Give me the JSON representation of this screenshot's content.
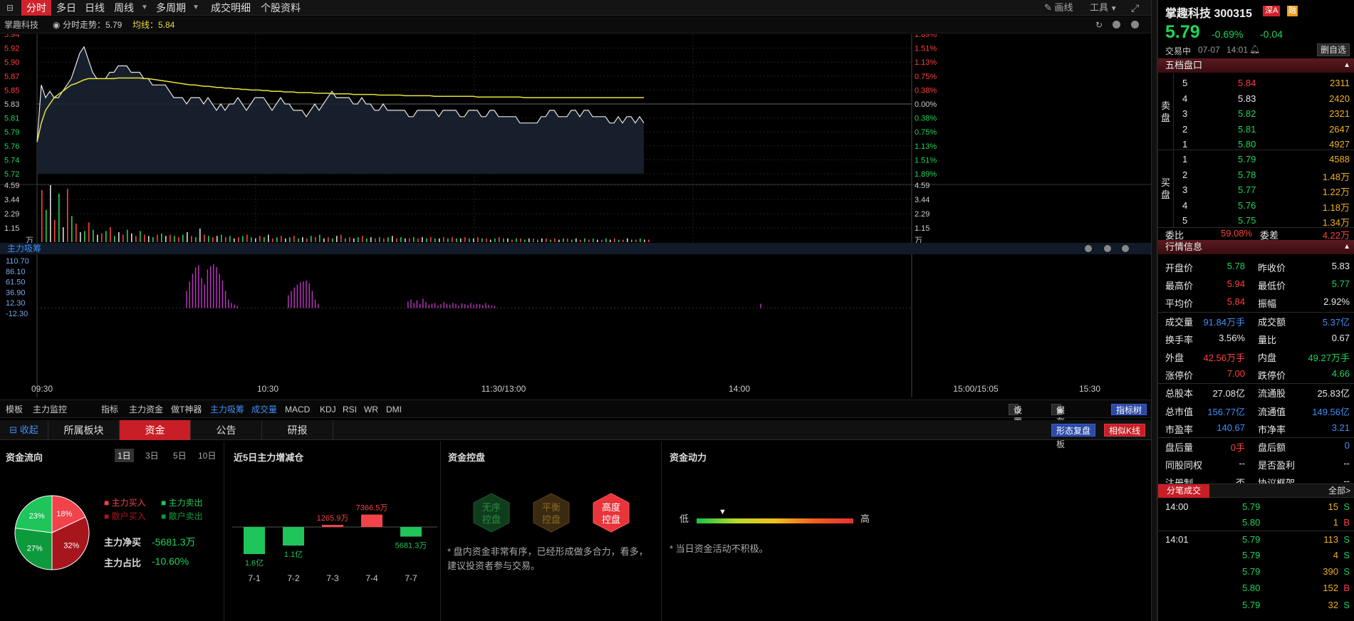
{
  "toolbar": {
    "tabs": [
      "分时",
      "多日",
      "日线",
      "周线",
      "多周期",
      "成交明细",
      "个股资料"
    ],
    "draw_label": "画线",
    "tools_label": "工具"
  },
  "infobar": {
    "stock_name": "掌趣科技",
    "trend_label": "分时走势：5.79",
    "avg_label": "均线：5.84"
  },
  "price_chart": {
    "type": "line",
    "left_ticks": [
      "5.94",
      "5.92",
      "5.90",
      "5.87",
      "5.85",
      "5.83",
      "5.81",
      "5.79",
      "5.76",
      "5.74",
      "5.72"
    ],
    "right_ticks": [
      "1.89%",
      "1.51%",
      "1.13%",
      "0.75%",
      "0.38%",
      "0.00%",
      "0.38%",
      "0.75%",
      "1.13%",
      "1.51%",
      "1.89%"
    ],
    "ylim": [
      5.72,
      5.94
    ],
    "prev_close": 5.83,
    "price": [
      5.77,
      5.86,
      5.84,
      5.85,
      5.84,
      5.84,
      5.85,
      5.86,
      5.87,
      5.89,
      5.91,
      5.92,
      5.9,
      5.88,
      5.87,
      5.87,
      5.87,
      5.88,
      5.88,
      5.89,
      5.89,
      5.89,
      5.88,
      5.88,
      5.88,
      5.87,
      5.87,
      5.86,
      5.86,
      5.86,
      5.86,
      5.85,
      5.84,
      5.84,
      5.84,
      5.83,
      5.84,
      5.84,
      5.84,
      5.83,
      5.84,
      5.83,
      5.82,
      5.83,
      5.82,
      5.83,
      5.83,
      5.84,
      5.83,
      5.82,
      5.83,
      5.84,
      5.84,
      5.84,
      5.83,
      5.82,
      5.83,
      5.84,
      5.83,
      5.83,
      5.82,
      5.82,
      5.82,
      5.81,
      5.82,
      5.83,
      5.82,
      5.83,
      5.84,
      5.85,
      5.84,
      5.84,
      5.84,
      5.84,
      5.83,
      5.83,
      5.84,
      5.83,
      5.83,
      5.82,
      5.82,
      5.83,
      5.82,
      5.82,
      5.82,
      5.82,
      5.82,
      5.81,
      5.81,
      5.82,
      5.82,
      5.82,
      5.82,
      5.82,
      5.81,
      5.82,
      5.82,
      5.82,
      5.82,
      5.81,
      5.81,
      5.82,
      5.82,
      5.82,
      5.81,
      5.81,
      5.82,
      5.82,
      5.81,
      5.81,
      5.81,
      5.81,
      5.81,
      5.8,
      5.8,
      5.8,
      5.8,
      5.8,
      5.81,
      5.81,
      5.82,
      5.82,
      5.81,
      5.81,
      5.81,
      5.82,
      5.82,
      5.81,
      5.82,
      5.82,
      5.81,
      5.81,
      5.81,
      5.81,
      5.8,
      5.8,
      5.81,
      5.8,
      5.81,
      5.81,
      5.8,
      5.81,
      5.8
    ],
    "avg": [
      5.77,
      5.8,
      5.82,
      5.83,
      5.84,
      5.845,
      5.85,
      5.855,
      5.86,
      5.862,
      5.865,
      5.868,
      5.87,
      5.87,
      5.87,
      5.87,
      5.87,
      5.87,
      5.87,
      5.871,
      5.871,
      5.871,
      5.871,
      5.871,
      5.871,
      5.87,
      5.87,
      5.869,
      5.868,
      5.867,
      5.866,
      5.865,
      5.864,
      5.863,
      5.862,
      5.861,
      5.86,
      5.86,
      5.859,
      5.858,
      5.858,
      5.857,
      5.856,
      5.856,
      5.855,
      5.855,
      5.854,
      5.854,
      5.853,
      5.853,
      5.852,
      5.852,
      5.852,
      5.851,
      5.851,
      5.85,
      5.85,
      5.85,
      5.849,
      5.849,
      5.849,
      5.848,
      5.848,
      5.848,
      5.848,
      5.847,
      5.847,
      5.847,
      5.847,
      5.846,
      5.846,
      5.846,
      5.846,
      5.846,
      5.845,
      5.845,
      5.845,
      5.845,
      5.845,
      5.845,
      5.844,
      5.844,
      5.844,
      5.844,
      5.844,
      5.844,
      5.843,
      5.843,
      5.843,
      5.843,
      5.843,
      5.843,
      5.843,
      5.842,
      5.842,
      5.842,
      5.842,
      5.842,
      5.842,
      5.842,
      5.842,
      5.842,
      5.842,
      5.841,
      5.841,
      5.841,
      5.841,
      5.841,
      5.841,
      5.841,
      5.841,
      5.841,
      5.841,
      5.841,
      5.84,
      5.84,
      5.84,
      5.84,
      5.84,
      5.84,
      5.84,
      5.84,
      5.84,
      5.84,
      5.84,
      5.84,
      5.84,
      5.84,
      5.84,
      5.84,
      5.84,
      5.84,
      5.84,
      5.84,
      5.84,
      5.84,
      5.84,
      5.84,
      5.84,
      5.84,
      5.84,
      5.84,
      5.84
    ]
  },
  "volume_chart": {
    "type": "bar",
    "ticks": [
      "4.59",
      "3.44",
      "2.29",
      "1.15"
    ],
    "unit": "万",
    "ylim": [
      0,
      4.59
    ],
    "values": [
      4.2,
      2.6,
      4.59,
      1.8,
      3.9,
      1.2,
      4.3,
      2.1,
      1.5,
      0.8,
      0.9,
      1.6,
      1.0,
      0.6,
      0.7,
      0.9,
      1.2,
      0.5,
      0.8,
      0.6,
      1.0,
      0.7,
      0.5,
      0.9,
      0.6,
      0.5,
      0.4,
      0.6,
      0.7,
      0.5,
      0.6,
      0.5,
      0.4,
      0.6,
      0.8,
      0.5,
      0.4,
      1.1,
      0.6,
      0.5,
      0.4,
      0.5,
      0.6,
      0.4,
      0.5,
      0.3,
      0.4,
      0.5,
      0.6,
      0.4,
      0.3,
      0.5,
      0.4,
      0.6,
      0.3,
      0.4,
      0.5,
      0.3,
      0.4,
      0.5,
      0.3,
      0.4,
      0.3,
      0.5,
      0.4,
      0.6,
      0.3,
      0.4,
      0.3,
      0.5,
      0.6,
      0.3,
      0.4,
      0.3,
      0.4,
      0.5,
      0.3,
      0.4,
      0.3,
      0.4,
      0.3,
      0.4,
      0.5,
      0.3,
      0.4,
      0.3,
      0.3,
      0.4,
      0.3,
      0.4,
      0.3,
      0.4,
      0.3,
      0.3,
      0.4,
      0.3,
      0.4,
      0.3,
      0.3,
      0.4,
      0.3,
      0.3,
      0.4,
      0.3,
      0.3,
      0.2,
      0.3,
      0.4,
      0.3,
      0.3,
      0.2,
      0.3,
      0.3,
      0.2,
      0.3,
      0.3,
      0.2,
      0.3,
      0.3,
      0.2,
      0.3,
      0.2,
      0.3,
      0.3,
      0.2,
      0.3,
      0.2,
      0.3,
      0.2,
      0.3,
      0.2,
      0.2,
      0.3,
      0.2,
      0.3,
      0.2,
      0.2,
      0.3,
      0.2,
      0.2,
      0.3,
      0.2,
      0.2
    ],
    "colors": "rgwrgwrgrwgrgwrg"
  },
  "capital_chart": {
    "title": "主力吸筹",
    "type": "bar",
    "ticks": [
      "110.70",
      "86.10",
      "61.50",
      "36.90",
      "12.30",
      "-12.30"
    ],
    "ylim": [
      -12.3,
      110.7
    ],
    "segments": [
      {
        "start": 50,
        "values": [
          40,
          62,
          80,
          95,
          100,
          70,
          55,
          90,
          98,
          102,
          96,
          80,
          64,
          40,
          20,
          12,
          8,
          5
        ]
      },
      {
        "start": 84,
        "values": [
          30,
          40,
          48,
          55,
          60,
          62,
          64,
          58,
          40,
          20,
          10
        ]
      },
      {
        "start": 124,
        "values": [
          15,
          20,
          12,
          18,
          10,
          22,
          14,
          8,
          10,
          12,
          6,
          9,
          14,
          10,
          8,
          12,
          10,
          6,
          11,
          9,
          7,
          12,
          8,
          10,
          9,
          7,
          12,
          8,
          6,
          5
        ]
      }
    ]
  },
  "time_axis": [
    "09:30",
    "10:30",
    "11:30/13:00",
    "14:00",
    "15:00/15:05",
    "15:30"
  ],
  "indicator_tabs": {
    "left": [
      "模板",
      "主力监控"
    ],
    "items": [
      "指标",
      "主力资金",
      "做T神器",
      "主力吸筹",
      "成交量",
      "MACD",
      "KDJ",
      "RSI",
      "WR",
      "DMI"
    ],
    "settings": "设置",
    "save_template": "保存模板",
    "indicator_tree": "指标树"
  },
  "bottom_tabs": {
    "collapse": "收起",
    "tabs": [
      "所属板块",
      "资金",
      "公告",
      "研报"
    ],
    "pattern_replay": "形态复盘",
    "similar_k": "相似K线"
  },
  "capital_flow": {
    "title": "资金流向",
    "periods": [
      "1日",
      "3日",
      "5日",
      "10日"
    ],
    "legend": [
      "主力买入",
      "主力卖出",
      "散户买入",
      "散户卖出"
    ],
    "pie": [
      {
        "label": "18%",
        "value": 18,
        "color": "#f2424a"
      },
      {
        "label": "32%",
        "value": 32,
        "color": "#a8161d"
      },
      {
        "label": "27%",
        "value": 27,
        "color": "#0d9a3c"
      },
      {
        "label": "23%",
        "value": 23,
        "color": "#1fc45a"
      }
    ],
    "net_buy_label": "主力净买",
    "net_buy_value": "-5681.3万",
    "ratio_label": "主力占比",
    "ratio_value": "-10.60%"
  },
  "five_day": {
    "title": "近5日主力增减仓",
    "chart_data": {
      "type": "bar",
      "categories": [
        "7-1",
        "7-2",
        "7-3",
        "7-4",
        "7-7"
      ],
      "values": [
        -16000,
        -11000,
        1265.9,
        7366.5,
        -5681.3
      ],
      "labels": [
        "1.6亿",
        "1.1亿",
        "1265.9万",
        "7366.5万",
        "5681.3万"
      ]
    }
  },
  "control": {
    "title": "资金控盘",
    "hexes": [
      "无序\n控盘",
      "平衡\n控盘",
      "高度\n控盘"
    ],
    "hex_a": "无序",
    "hex_b": "控盘",
    "hex_c": "平衡",
    "hex_d": "控盘",
    "hex_e": "高度",
    "hex_f": "控盘",
    "note": "* 盘内资金非常有序，已经形成做多合力，看多，建议投资者参与交易。"
  },
  "power": {
    "title": "资金动力",
    "low": "低",
    "high": "高",
    "note": "* 当日资金活动不积极。"
  },
  "quote": {
    "name": "掌趣科技 300315",
    "market_badge": "深A",
    "margin_badge": "融",
    "price": "5.79",
    "change_pct": "-0.69%",
    "change": "-0.04",
    "status": "交易中",
    "date": "07-07",
    "time": "14:01",
    "remove_watch": "删自选"
  },
  "order_book": {
    "title": "五档盘口",
    "sell_label": "卖盘",
    "buy_label": "买盘",
    "sells": [
      {
        "lvl": "5",
        "price": "5.84",
        "vol": "2311",
        "pc": "red"
      },
      {
        "lvl": "4",
        "price": "5.83",
        "vol": "2420",
        "pc": "white"
      },
      {
        "lvl": "3",
        "price": "5.82",
        "vol": "2321",
        "pc": "green"
      },
      {
        "lvl": "2",
        "price": "5.81",
        "vol": "2647",
        "pc": "green"
      },
      {
        "lvl": "1",
        "price": "5.80",
        "vol": "4927",
        "pc": "green"
      }
    ],
    "buys": [
      {
        "lvl": "1",
        "price": "5.79",
        "vol": "4588",
        "pc": "green"
      },
      {
        "lvl": "2",
        "price": "5.78",
        "vol": "1.48万",
        "pc": "green"
      },
      {
        "lvl": "3",
        "price": "5.77",
        "vol": "1.22万",
        "pc": "green"
      },
      {
        "lvl": "4",
        "price": "5.76",
        "vol": "1.18万",
        "pc": "green"
      },
      {
        "lvl": "5",
        "price": "5.75",
        "vol": "1.34万",
        "pc": "green"
      }
    ],
    "ratio_label": "委比",
    "ratio_value": "59.08%",
    "diff_label": "委差",
    "diff_value": "4.22万"
  },
  "market_info": {
    "title": "行情信息",
    "rows": [
      [
        {
          "k": "开盘价",
          "v": "5.78",
          "c": "green"
        },
        {
          "k": "昨收价",
          "v": "5.83",
          "c": "white"
        }
      ],
      [
        {
          "k": "最高价",
          "v": "5.94",
          "c": "red"
        },
        {
          "k": "最低价",
          "v": "5.77",
          "c": "green"
        }
      ],
      [
        {
          "k": "平均价",
          "v": "5.84",
          "c": "red"
        },
        {
          "k": "振幅",
          "v": "2.92%",
          "c": "white"
        }
      ],
      [
        {
          "k": "成交量",
          "v": "91.84万手",
          "c": "blue"
        },
        {
          "k": "成交额",
          "v": "5.37亿",
          "c": "blue"
        }
      ],
      [
        {
          "k": "换手率",
          "v": "3.56%",
          "c": "white"
        },
        {
          "k": "量比",
          "v": "0.67",
          "c": "white"
        }
      ],
      [
        {
          "k": "外盘",
          "v": "42.56万手",
          "c": "red"
        },
        {
          "k": "内盘",
          "v": "49.27万手",
          "c": "green"
        }
      ],
      [
        {
          "k": "涨停价",
          "v": "7.00",
          "c": "red"
        },
        {
          "k": "跌停价",
          "v": "4.66",
          "c": "green"
        }
      ],
      [
        {
          "k": "总股本",
          "v": "27.08亿",
          "c": "white"
        },
        {
          "k": "流通股",
          "v": "25.83亿",
          "c": "white"
        }
      ],
      [
        {
          "k": "总市值",
          "v": "156.77亿",
          "c": "blue"
        },
        {
          "k": "流通值",
          "v": "149.56亿",
          "c": "blue"
        }
      ],
      [
        {
          "k": "市盈率",
          "v": "140.67",
          "c": "blue"
        },
        {
          "k": "市净率",
          "v": "3.21",
          "c": "blue"
        }
      ],
      [
        {
          "k": "盘后量",
          "v": "0手",
          "c": "red"
        },
        {
          "k": "盘后额",
          "v": "0",
          "c": "blue"
        }
      ],
      [
        {
          "k": "同股同权",
          "v": "--",
          "c": "white"
        },
        {
          "k": "是否盈利",
          "v": "--",
          "c": "white"
        }
      ],
      [
        {
          "k": "注册制",
          "v": "否",
          "c": "white"
        },
        {
          "k": "协议框架",
          "v": "--",
          "c": "white"
        }
      ]
    ]
  },
  "ticks": {
    "title": "分笔成交",
    "all_label": "全部>",
    "rows": [
      {
        "t": "14:00",
        "p": "5.79",
        "v": "15",
        "s": "S",
        "pc": "green"
      },
      {
        "t": "",
        "p": "5.80",
        "v": "1",
        "s": "B",
        "pc": "green"
      },
      {
        "t": "14:01",
        "p": "5.79",
        "v": "113",
        "s": "S",
        "pc": "green"
      },
      {
        "t": "",
        "p": "5.79",
        "v": "4",
        "s": "S",
        "pc": "green"
      },
      {
        "t": "",
        "p": "5.79",
        "v": "390",
        "s": "S",
        "pc": "green"
      },
      {
        "t": "",
        "p": "5.80",
        "v": "152",
        "s": "B",
        "pc": "green"
      },
      {
        "t": "",
        "p": "5.79",
        "v": "32",
        "s": "S",
        "pc": "green"
      }
    ]
  },
  "colors": {
    "accent": "#d0232b",
    "up": "#ff4040",
    "down": "#1fd45a",
    "avg_line": "#e8e33a",
    "capital_bar": "#c233c8"
  }
}
